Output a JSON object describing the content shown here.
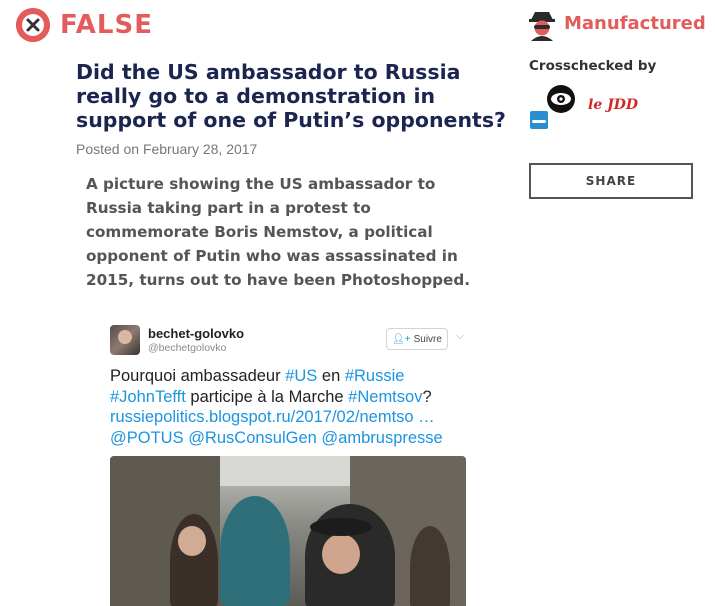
{
  "verdict": {
    "label": "FALSE",
    "color": "#e35b5b",
    "icon": "x-circle-icon"
  },
  "article": {
    "title": "Did the US ambassador to Russia really go to a demonstration in support of one of Putin’s opponents?",
    "posted": "Posted on February 28, 2017",
    "summary": "A picture showing the US ambassador to Russia taking part in a protest to commemorate Boris Nemstov, a political opponent of Putin who was assassinated in 2015, turns out to have been Photoshopped."
  },
  "sidebar": {
    "category": {
      "label": "Manufactured",
      "icon": "spy-icon"
    },
    "crosschecked_title": "Crosschecked by",
    "partners": [
      {
        "name": "eye-logo"
      },
      {
        "name": "le JDD"
      },
      {
        "name": "blue-logo"
      }
    ],
    "partner_jdd_text": "le JDD",
    "share_label": "SHARE"
  },
  "tweet": {
    "username": "bechet-golovko",
    "handle": "@bechetgolovko",
    "follow_label": "Suivre",
    "text": {
      "part1": "Pourquoi ambassadeur ",
      "tag_us": "#US",
      "part2": " en ",
      "tag_russie": "#Russie",
      "tag_john": "#JohnTefft",
      "part3": " participe à la Marche ",
      "tag_nemtsov": "#Nemtsov",
      "part4": "?",
      "link": "russiepolitics.blogspot.ru/2017/02/nemtso …",
      "mention1": "@POTUS",
      "mention2": "@RusConsulGen",
      "mention3": "@ambruspresse"
    }
  }
}
